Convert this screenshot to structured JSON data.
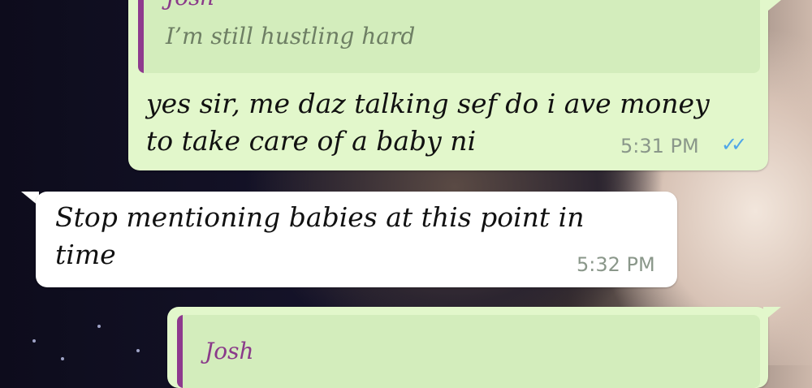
{
  "messages": [
    {
      "direction": "outgoing",
      "quote": {
        "author": "Josh",
        "text": "I’m still hustling hard"
      },
      "line1": "yes sir, me daz talking sef do i ave money",
      "line2": "to take care of a baby ni",
      "time": "5:31 PM",
      "status": "read",
      "status_glyph": "✓✓"
    },
    {
      "direction": "incoming",
      "line1": "Stop mentioning babies at this point in",
      "line2": "time",
      "time": "5:32 PM"
    },
    {
      "direction": "outgoing",
      "quote": {
        "author": "Josh"
      }
    }
  ],
  "colors": {
    "outgoing_bubble": "#e2f7cb",
    "incoming_bubble": "#ffffff",
    "quote_bar": "#8e3a8e",
    "read_ticks": "#4fa6e8"
  }
}
